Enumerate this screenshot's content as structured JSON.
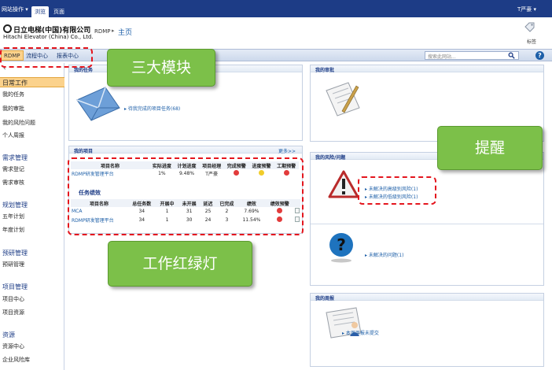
{
  "ribbon": {
    "site_actions": "网站操作 ▾",
    "tabs": [
      "浏览",
      "页面"
    ],
    "user": "T严豪 ▾"
  },
  "header": {
    "logo_cn": "日立电梯(中国)有限公司",
    "logo_en": "Hitachi Elevator (China) Co., Ltd.",
    "breadcrumb_site": "RDMP",
    "breadcrumb_arrow": "▸",
    "breadcrumb_page": "主页",
    "tag_label": "标签"
  },
  "topnav": {
    "items": [
      "RDMP",
      "流程中心",
      "报表中心"
    ],
    "search_placeholder": "搜索此网站...",
    "help": "?"
  },
  "sidebar": {
    "back": "‹",
    "groups": [
      {
        "head": "日常工作",
        "items": [
          "我的任务",
          "我的审批",
          "我的风险问题",
          "个人周报"
        ]
      },
      {
        "head": "需求管理",
        "items": [
          "需求登记",
          "需求审核"
        ]
      },
      {
        "head": "规划管理",
        "items": [
          "五年计划",
          "年度计划"
        ]
      },
      {
        "head": "预研管理",
        "items": [
          "预研管理"
        ]
      },
      {
        "head": "项目管理",
        "items": [
          "项目中心",
          "项目资源"
        ]
      },
      {
        "head": "资源",
        "items": [
          "资源中心",
          "企业风险库"
        ]
      }
    ]
  },
  "panels": {
    "tasks": {
      "title": "我的任务",
      "link": "▸ 待我完成的项目任务(68)"
    },
    "projects": {
      "title": "我的项目",
      "more": "更多>>",
      "headers": [
        "项目名称",
        "实际进度",
        "计划进度",
        "项目经理",
        "完成预警",
        "进度预警",
        "工期预警"
      ],
      "rows": [
        [
          "RDMP研发管理平台",
          "1%",
          "9.48%",
          "T严豪"
        ]
      ],
      "sub_title": "任务绩效",
      "task_headers": [
        "项目名称",
        "总任务数",
        "开展中",
        "未开展",
        "延迟",
        "已完成",
        "绩效",
        "绩效预警"
      ],
      "task_rows": [
        [
          "MCA",
          "34",
          "1",
          "31",
          "25",
          "2",
          "7.69%"
        ],
        [
          "RDMP研发管理平台",
          "34",
          "1",
          "30",
          "24",
          "3",
          "11.54%"
        ]
      ]
    },
    "approval": {
      "title": "我的审批"
    },
    "risk": {
      "title": "我的风险/问题",
      "link1": "▸ 未解决的高级别风险(1)",
      "link2": "▸ 未解决的低级别风险(1)",
      "link3": "▸ 未解决的问题(1)"
    },
    "weekly": {
      "title": "我的周报",
      "link": "▸ 本周周报未提交"
    }
  },
  "callouts": {
    "modules": "三大模块",
    "reminder": "提醒",
    "traffic_light": "工作红绿灯"
  },
  "colors": {
    "ribbon": "#1d3c86",
    "callout": "#7cc049",
    "dashed": "#e4161e",
    "red_light": "#e23b3b",
    "yellow_light": "#f1cc2a"
  }
}
